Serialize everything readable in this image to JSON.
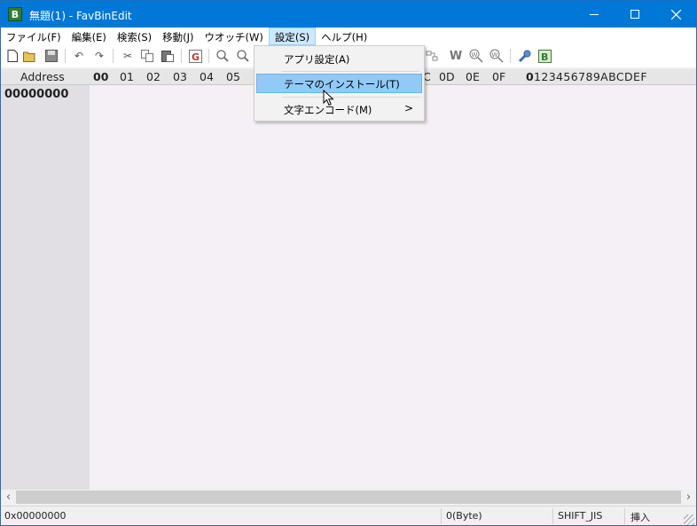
{
  "window": {
    "title": "無題(1) - FavBinEdit",
    "app_icon_letter": "B"
  },
  "menubar": {
    "items": [
      "ファイル(F)",
      "編集(E)",
      "検索(S)",
      "移動(J)",
      "ウオッチ(W)",
      "設定(S)",
      "ヘルプ(H)"
    ]
  },
  "dropdown": {
    "items": [
      "アプリ設定(A)",
      "テーマのインストール(T)",
      "文字エンコード(M)"
    ],
    "submenu_arrow": ">"
  },
  "hex_header": {
    "address_label": "Address",
    "left_columns": [
      "00",
      "01",
      "02",
      "03",
      "04",
      "05"
    ],
    "right_columns": [
      "C",
      "0D",
      "0E",
      "0F"
    ],
    "ascii_first": "0",
    "ascii_rest": "123456789ABCDEF"
  },
  "editor": {
    "first_address": "00000000"
  },
  "statusbar": {
    "offset": "0x00000000",
    "size": "0(Byte)",
    "encoding": "SHIFT_JIS",
    "mode": "挿入"
  },
  "colors": {
    "titlebar": "#0078d7",
    "menu_highlight": "#91c9f7",
    "editor_bg": "#f5f0f5",
    "address_bg": "#e1dfe3"
  }
}
